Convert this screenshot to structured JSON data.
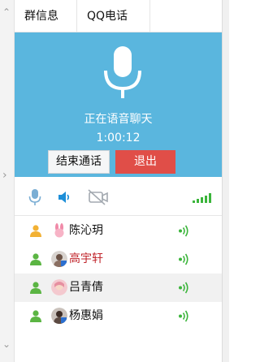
{
  "tabs": [
    {
      "label": "群信息"
    },
    {
      "label": "QQ电话"
    }
  ],
  "call": {
    "status": "正在语音聊天",
    "timer": "1:00:12",
    "end_label": "结束通话",
    "quit_label": "退出"
  },
  "controls": {
    "mic": "microphone-icon",
    "speaker": "speaker-icon",
    "camera": "camera-off-icon",
    "signal": "signal-strength-icon"
  },
  "members": [
    {
      "name": "陈沁玥",
      "name_color": "#111111",
      "avatar": "bunny-avatar"
    },
    {
      "name": "高宇轩",
      "name_color": "#c0242b",
      "avatar": "photo-avatar"
    },
    {
      "name": "吕青倩",
      "name_color": "#111111",
      "avatar": "photo-avatar"
    },
    {
      "name": "杨惠娟",
      "name_color": "#111111",
      "avatar": "photo-avatar"
    }
  ],
  "colors": {
    "panel": "#5ab6de",
    "quit": "#e04e48",
    "accent_green": "#3bb53b"
  }
}
